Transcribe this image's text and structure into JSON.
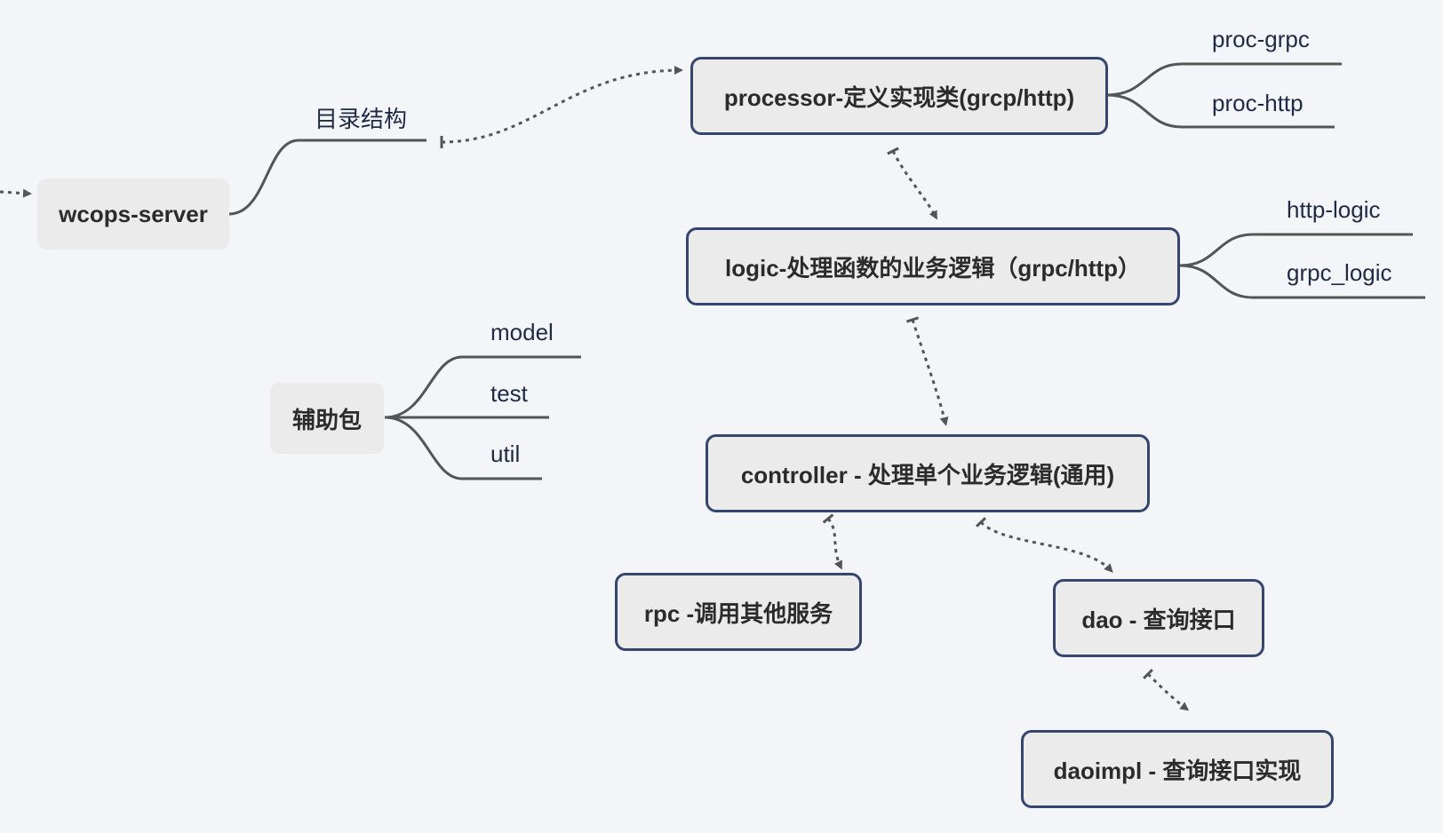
{
  "root": {
    "label": "wcops-server"
  },
  "branch_main": {
    "label": "目录结构"
  },
  "helper": {
    "label": "辅助包",
    "children": [
      "model",
      "test",
      "util"
    ]
  },
  "processor": {
    "label": "processor-定义实现类(grcp/http)",
    "children": [
      "proc-grpc",
      "proc-http"
    ]
  },
  "logic": {
    "label": "logic-处理函数的业务逻辑（grpc/http）",
    "children": [
      "http-logic",
      "grpc_logic"
    ]
  },
  "controller": {
    "label": "controller - 处理单个业务逻辑(通用)"
  },
  "rpc": {
    "label": "rpc -调用其他服务"
  },
  "dao": {
    "label": "dao - 查询接口"
  },
  "daoimpl": {
    "label": "daoimpl - 查询接口实现"
  },
  "colors": {
    "background": "#f4f5f9",
    "topic_fill": "#ebebeb",
    "topic_border": "#34456e",
    "line": "#555555",
    "text": "#2b2b2b"
  }
}
